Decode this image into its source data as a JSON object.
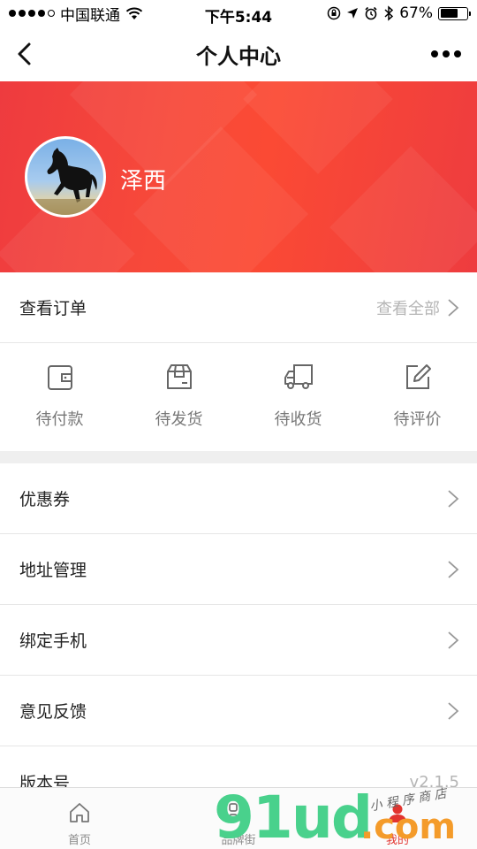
{
  "status_bar": {
    "carrier": "中国联通",
    "time": "下午5:44",
    "battery_percent": "67%",
    "battery_level": 0.67
  },
  "nav": {
    "title": "个人中心"
  },
  "profile": {
    "username": "泽西",
    "banner_color": "#f7493a"
  },
  "orders": {
    "label": "查看订单",
    "view_all": "查看全部",
    "items": [
      {
        "label": "待付款",
        "icon": "wallet-icon"
      },
      {
        "label": "待发货",
        "icon": "package-icon"
      },
      {
        "label": "待收货",
        "icon": "truck-icon"
      },
      {
        "label": "待评价",
        "icon": "edit-icon"
      }
    ]
  },
  "menu": {
    "items": [
      {
        "label": "优惠券"
      },
      {
        "label": "地址管理"
      },
      {
        "label": "绑定手机"
      },
      {
        "label": "意见反馈"
      }
    ],
    "version_label": "版本号",
    "version_value": "v2.1.5"
  },
  "tabbar": {
    "items": [
      {
        "label": "首页",
        "icon": "home-icon"
      },
      {
        "label": "品牌街",
        "icon": "grid-icon"
      },
      {
        "label": "我的",
        "icon": "user-icon"
      }
    ],
    "active_color": "#e2342f"
  },
  "watermark": {
    "main": "91ud",
    "suffix": ".com",
    "tagline": "小 程 序 商 店"
  }
}
